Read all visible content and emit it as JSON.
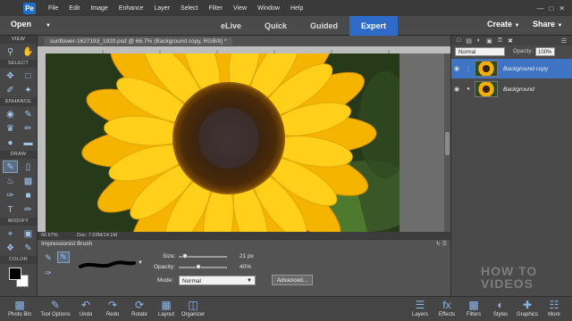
{
  "menu": {
    "app_icon": "photoshop-elements-logo",
    "items": [
      "File",
      "Edit",
      "Image",
      "Enhance",
      "Layer",
      "Select",
      "Filter",
      "View",
      "Window",
      "Help"
    ]
  },
  "modebar": {
    "open_label": "Open",
    "modes": [
      "eLive",
      "Quick",
      "Guided",
      "Expert"
    ],
    "active_mode": "Expert",
    "create_label": "Create",
    "share_label": "Share"
  },
  "toolbox": {
    "sections": [
      "VIEW",
      "SELECT",
      "ENHANCE",
      "DRAW",
      "MODIFY",
      "COLOR"
    ],
    "colors": {
      "foreground": "#000000",
      "background": "#ffffff"
    }
  },
  "document": {
    "tab_title": "sunflower-1627193_1920.psd @ 66.7% (Background copy, RGB/8) *",
    "zoom": "66.67%",
    "doc_size": "Doc: 7.03M/14.1M"
  },
  "layers": {
    "blend_mode": "Normal",
    "opacity_label": "Opacity:",
    "opacity_value": "100%",
    "items": [
      {
        "name": "Background copy",
        "active": true
      },
      {
        "name": "Background",
        "active": false
      }
    ]
  },
  "tool_options": {
    "title": "Impressionist Brush",
    "size_label": "Size:",
    "size_value": "21 px",
    "size_fraction": 0.08,
    "opacity_label": "Opacity:",
    "opacity_value": "40%",
    "opacity_fraction": 0.4,
    "mode_label": "Mode:",
    "mode_value": "Normal",
    "advanced_label": "Advanced..."
  },
  "bottombar": {
    "left": [
      {
        "label": "Photo Bin",
        "icon": "photo-bin-icon"
      },
      {
        "label": "Tool Options",
        "icon": "tool-options-icon"
      },
      {
        "label": "Undo",
        "icon": "undo-icon"
      },
      {
        "label": "Redo",
        "icon": "redo-icon"
      },
      {
        "label": "Rotate",
        "icon": "rotate-icon"
      },
      {
        "label": "Layout",
        "icon": "layout-icon"
      },
      {
        "label": "Organizer",
        "icon": "organizer-icon"
      }
    ],
    "right": [
      {
        "label": "Layers",
        "icon": "layers-icon"
      },
      {
        "label": "Effects",
        "icon": "effects-icon"
      },
      {
        "label": "Filters",
        "icon": "filters-icon"
      },
      {
        "label": "Styles",
        "icon": "styles-icon"
      },
      {
        "label": "Graphics",
        "icon": "graphics-icon"
      },
      {
        "label": "More",
        "icon": "more-icon"
      }
    ]
  },
  "watermark": "HOW TO VIDEOS",
  "accent_color": "#2e6ac7"
}
